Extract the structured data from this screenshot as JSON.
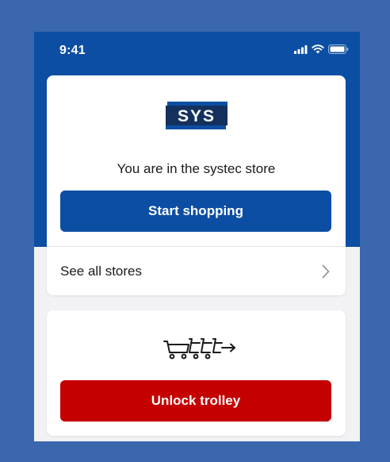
{
  "status_bar": {
    "time": "9:41",
    "icons": [
      "signal-icon",
      "wifi-icon",
      "battery-icon"
    ]
  },
  "store_card": {
    "logo_text": "SYS",
    "store_message": "You are in the systec store",
    "start_button_label": "Start shopping",
    "see_all_label": "See all stores",
    "chevron_icon": "chevron-right-icon"
  },
  "trolley_card": {
    "icon": "trolley-unlock-icon",
    "unlock_button_label": "Unlock trolley"
  },
  "colors": {
    "background": "#3a67ad",
    "brand_blue": "#0c4ea3",
    "unlock_red": "#c50000",
    "surface": "#f2f2f4"
  }
}
